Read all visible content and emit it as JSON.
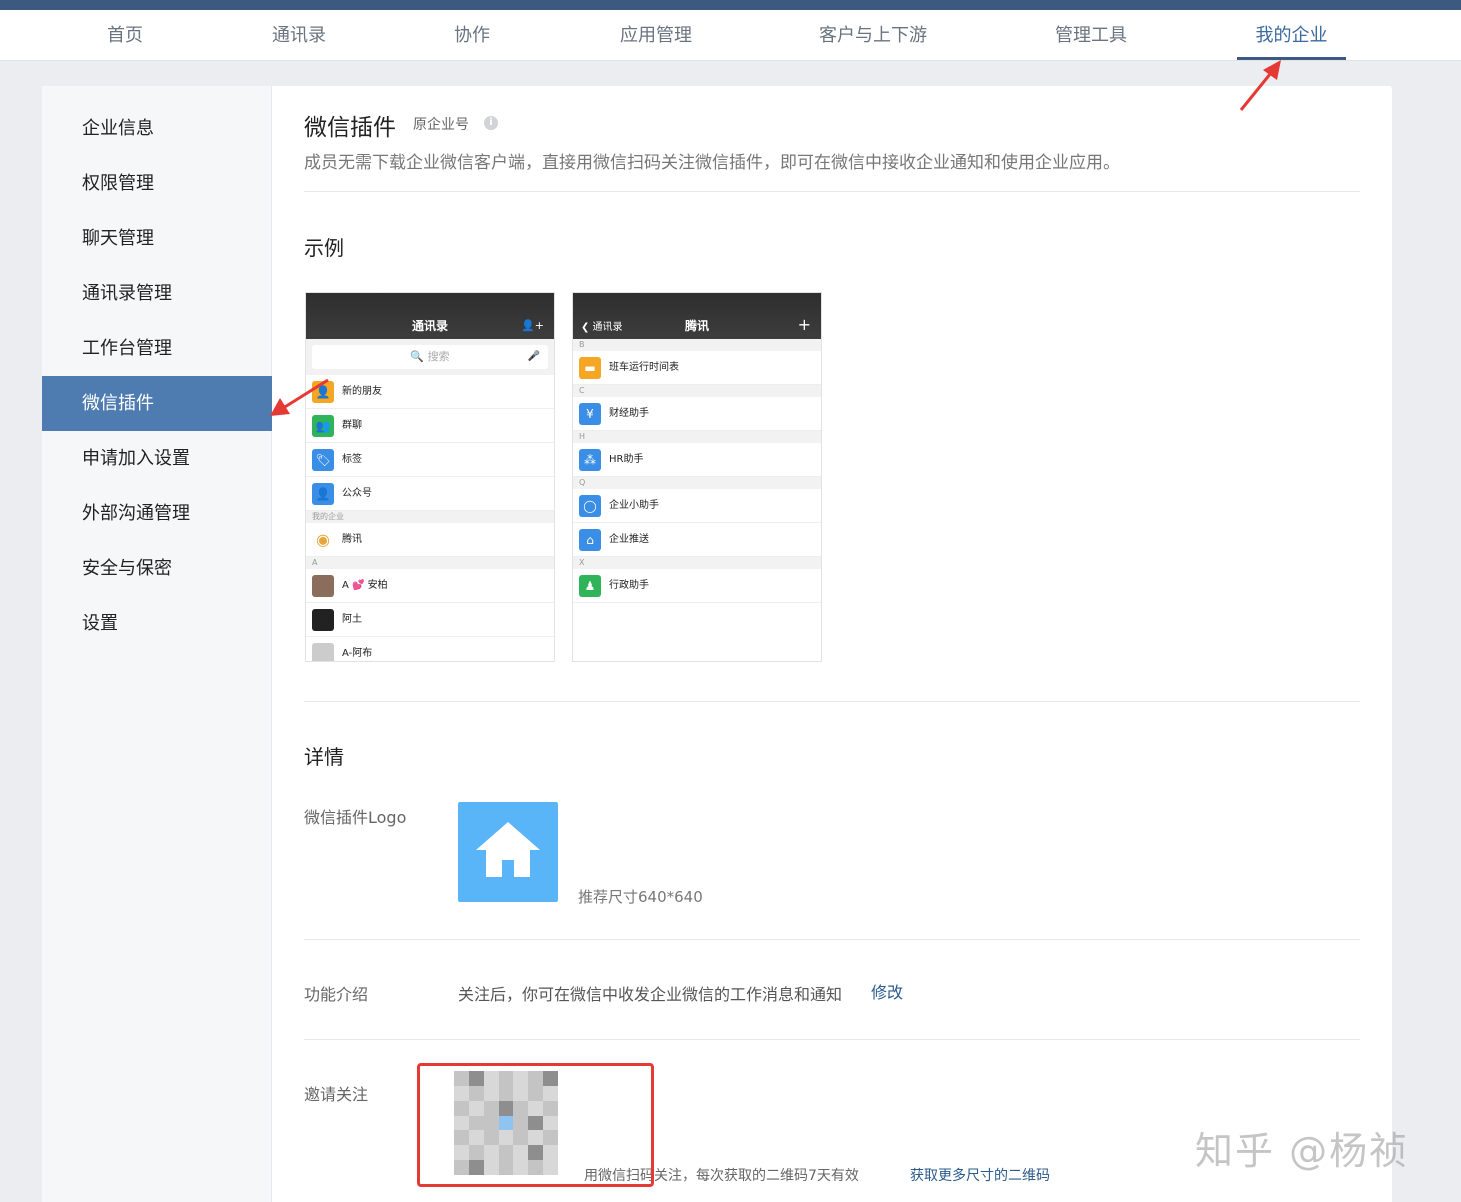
{
  "nav": {
    "items": [
      "首页",
      "通讯录",
      "协作",
      "应用管理",
      "客户与上下游",
      "管理工具",
      "我的企业"
    ],
    "active_index": 6
  },
  "sidebar": {
    "items": [
      "企业信息",
      "权限管理",
      "聊天管理",
      "通讯录管理",
      "工作台管理",
      "微信插件",
      "申请加入设置",
      "外部沟通管理",
      "安全与保密",
      "设置"
    ],
    "active_index": 5
  },
  "header": {
    "title": "微信插件",
    "tag": "原企业号",
    "info_icon": "i",
    "description": "成员无需下载企业微信客户端，直接用微信扫码关注微信插件，即可在微信中接收企业通知和使用企业应用。"
  },
  "example": {
    "title": "示例",
    "phone1": {
      "title": "通讯录",
      "right_icon": "👤+",
      "search": "🔍 搜索",
      "mic": "🎤",
      "rows": [
        {
          "label": "新的朋友",
          "color": "#f5a623",
          "icon": "👤"
        },
        {
          "label": "群聊",
          "color": "#2fb45a",
          "icon": "👥"
        },
        {
          "label": "标签",
          "color": "#3a8ee6",
          "icon": "🏷"
        },
        {
          "label": "公众号",
          "color": "#3a8ee6",
          "icon": "👤"
        }
      ],
      "group1": "我的企业",
      "company": {
        "label": "腾讯",
        "color": "#ffffff",
        "icon": "◉"
      },
      "group2": "A",
      "contacts": [
        {
          "label": "A 💕 安柏",
          "color": "#8a6d5a",
          "icon": ""
        },
        {
          "label": "阿土",
          "color": "#222222",
          "icon": ""
        },
        {
          "label": "A-阿布",
          "color": "#cccccc",
          "icon": ""
        }
      ]
    },
    "phone2": {
      "title": "腾讯",
      "back": "❮ 通讯录",
      "right_icon": "+",
      "sections": [
        {
          "letter": "B",
          "rows": [
            {
              "label": "班车运行时间表",
              "color": "#f5a623",
              "icon": "▬"
            }
          ]
        },
        {
          "letter": "C",
          "rows": [
            {
              "label": "财经助手",
              "color": "#3a8ee6",
              "icon": "¥"
            }
          ]
        },
        {
          "letter": "H",
          "rows": [
            {
              "label": "HR助手",
              "color": "#3a8ee6",
              "icon": "⁂"
            }
          ]
        },
        {
          "letter": "Q",
          "rows": [
            {
              "label": "企业小助手",
              "color": "#3a8ee6",
              "icon": "◯"
            },
            {
              "label": "企业推送",
              "color": "#3a8ee6",
              "icon": "⌂"
            }
          ]
        },
        {
          "letter": "X",
          "rows": [
            {
              "label": "行政助手",
              "color": "#2fb45a",
              "icon": "♟"
            }
          ]
        }
      ]
    }
  },
  "details": {
    "title": "详情",
    "logo_label": "微信插件Logo",
    "logo_hint": "推荐尺寸640*640",
    "func_label": "功能介绍",
    "func_text": "关注后，你可在微信中收发企业微信的工作消息和通知",
    "modify_label": "修改",
    "invite_label": "邀请关注",
    "qr_text": "用微信扫码关注，每次获取的二维码7天有效",
    "qr_link": "获取更多尺寸的二维码"
  },
  "watermark": "知乎 @杨祯",
  "colors": {
    "accent": "#4e7bb0",
    "nav_active": "#3c5a80",
    "annotation": "#e53935",
    "logo": "#5ab4f8"
  }
}
